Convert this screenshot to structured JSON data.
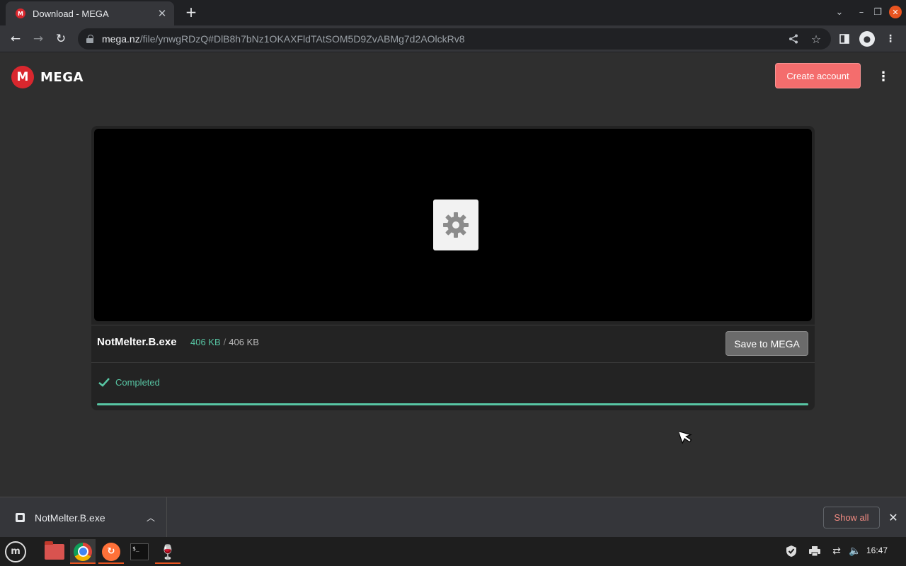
{
  "browser": {
    "tab_title": "Download - MEGA",
    "tab_favicon": "M",
    "url_host": "mega.nz",
    "url_path": "/file/ynwgRDzQ#DlB8h7bNz1OKAXFldTAtSOM5D9ZvABMg7d2AOlckRv8"
  },
  "header": {
    "logo_letter": "M",
    "logo_text": "MEGA",
    "create_account_label": "Create account"
  },
  "download": {
    "filename": "NotMelter.B.exe",
    "downloaded": "406 KB",
    "separator": "/",
    "total": "406 KB",
    "save_label": "Save to MEGA",
    "status": "Completed",
    "progress_fraction": 1.0,
    "status_color": "#58c6a4"
  },
  "shelf": {
    "item_name": "NotMelter.B.exe",
    "show_all_label": "Show all"
  },
  "taskbar": {
    "clock": "16:47",
    "apps": [
      "mint-menu-icon",
      "files-icon",
      "chrome-icon",
      "firefox-icon",
      "terminal-icon",
      "wine-icon"
    ]
  },
  "colors": {
    "accent": "#d9272e",
    "create_button": "#f46d6d"
  }
}
